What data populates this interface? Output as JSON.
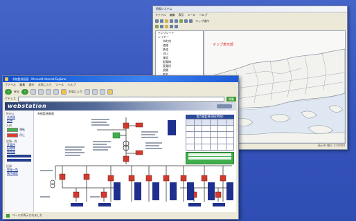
{
  "map_window": {
    "title": "地図システム",
    "menus": [
      "ファイル",
      "編集",
      "表示",
      "ツール",
      "ヘルプ"
    ],
    "toolbar_label": "マップ操作",
    "tree_items": [
      {
        "label": "テンプレート",
        "level": 0
      },
      {
        "label": "レイヤー",
        "level": 0
      },
      {
        "label": "市町村",
        "level": 1
      },
      {
        "label": "道路",
        "level": 1
      },
      {
        "label": "鉄道",
        "level": 1
      },
      {
        "label": "河川",
        "level": 1
      },
      {
        "label": "施設",
        "level": 1
      },
      {
        "label": "配電線",
        "level": 1
      },
      {
        "label": "変電所",
        "level": 1
      },
      {
        "label": "設備",
        "level": 1
      },
      {
        "label": "地名",
        "level": 1
      }
    ],
    "map_label": "マップ表示部",
    "status_text": "表示中  縮尺 1:50000"
  },
  "web_window": {
    "title": "系統監視画面 - Microsoft Internet Explorer",
    "menus": [
      "ファイル",
      "編集",
      "表示",
      "お気に入り",
      "ツール",
      "ヘルプ"
    ],
    "back_label": "戻る",
    "favorites_label": "お気に入り",
    "address_label": "アドレス",
    "go_label": "移動",
    "logo": "webstation",
    "page_title": "系統監視画面",
    "sidebar": {
      "sections": [
        {
          "heading": "Menu",
          "links": [
            "系統図",
            "監視"
          ]
        },
        {
          "heading": "凡例",
          "links": [
            "運転",
            "停止"
          ]
        },
        {
          "heading": "設備一覧",
          "links": [
            "変電所",
            "配電線",
            "開閉器"
          ]
        },
        {
          "heading": "記録",
          "links": [
            "警報一覧",
            "操作履歴"
          ]
        }
      ]
    },
    "table_title": "電力量監視(現在時刻)",
    "status_text": "ページが表示されました"
  },
  "colors": {
    "background": "#3a5cc0",
    "breaker_red": "#d23a2e",
    "feeder_navy": "#1f2f8e",
    "closed_green": "#3fae4b"
  }
}
